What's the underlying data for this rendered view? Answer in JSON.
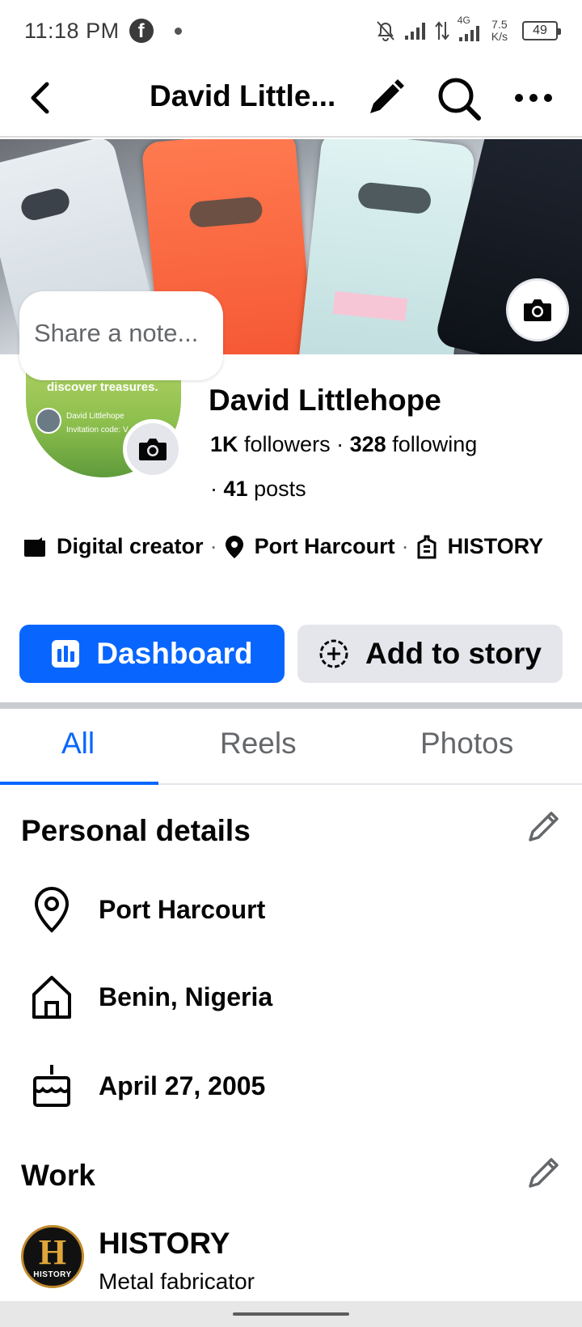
{
  "status_bar": {
    "time": "11:18 PM",
    "network_type": "4G",
    "net_speed_value": "7.5",
    "net_speed_unit": "K/s",
    "battery": "49"
  },
  "header": {
    "title": "David Little...",
    "icons": [
      "back-icon",
      "edit-icon",
      "search-icon",
      "more-icon"
    ]
  },
  "cover": {
    "note_placeholder": "Share a note..."
  },
  "avatar": {
    "overlay_text": "discover treasures.",
    "overlay_name": "David Littlehope",
    "overlay_code": "Invitation code: V"
  },
  "profile": {
    "name": "David Littlehope",
    "followers_count": "1K",
    "followers_label": "followers",
    "following_count": "328",
    "following_label": "following",
    "posts_prefix": "·",
    "posts_count": "41",
    "posts_label": "posts",
    "separator": "·",
    "intro": {
      "category": "Digital creator",
      "location": "Port Harcourt",
      "work": "HISTORY"
    }
  },
  "actions": {
    "dashboard": "Dashboard",
    "add_story": "Add to story"
  },
  "tabs": [
    {
      "label": "All",
      "active": true
    },
    {
      "label": "Reels",
      "active": false
    },
    {
      "label": "Photos",
      "active": false
    }
  ],
  "personal_details": {
    "title": "Personal details",
    "items": [
      {
        "icon": "location-pin-icon",
        "text": "Port Harcourt"
      },
      {
        "icon": "home-icon",
        "text": "Benin, Nigeria"
      },
      {
        "icon": "birthday-cake-icon",
        "text": "April 27, 2005"
      }
    ]
  },
  "work": {
    "title": "Work",
    "company": "HISTORY",
    "logo_letter": "H",
    "logo_label": "HISTORY",
    "role": "Metal fabricator"
  },
  "colors": {
    "accent": "#0866ff",
    "secondary_button": "#e4e6eb",
    "text_primary": "#050505",
    "text_secondary": "#65676b"
  }
}
